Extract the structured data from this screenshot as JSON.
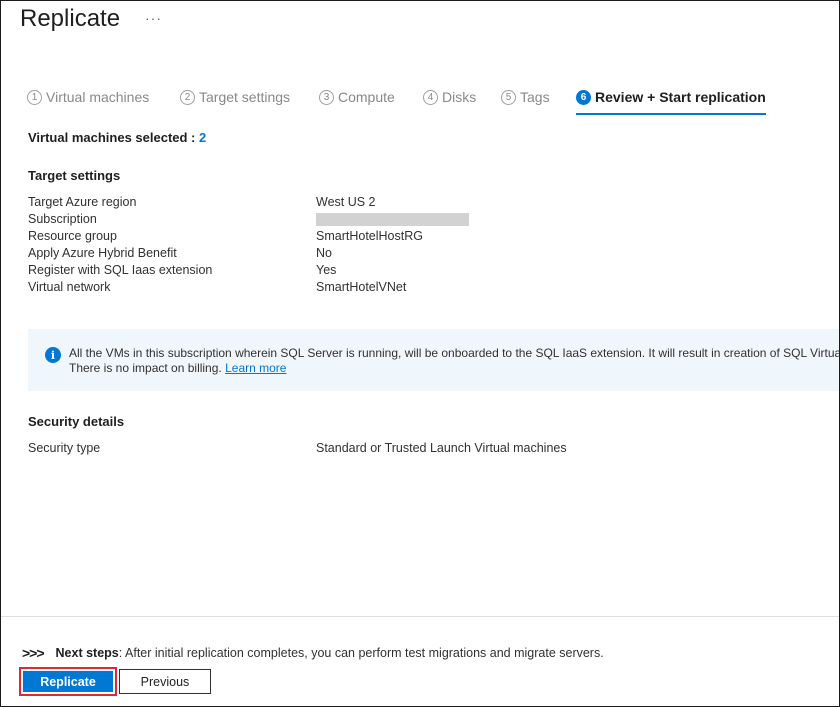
{
  "header": {
    "title": "Replicate",
    "more": "···"
  },
  "steps": [
    {
      "num": "1",
      "label": "Virtual machines"
    },
    {
      "num": "2",
      "label": "Target settings"
    },
    {
      "num": "3",
      "label": "Compute"
    },
    {
      "num": "4",
      "label": "Disks"
    },
    {
      "num": "5",
      "label": "Tags"
    },
    {
      "num": "6",
      "label": "Review + Start replication"
    }
  ],
  "summary": {
    "label": "Virtual machines selected :",
    "count": "2"
  },
  "target_settings": {
    "heading": "Target settings",
    "rows": [
      {
        "key": "Target Azure region",
        "value": "West US 2"
      },
      {
        "key": "Subscription",
        "value": ""
      },
      {
        "key": "Resource group",
        "value": "SmartHotelHostRG"
      },
      {
        "key": "Apply Azure Hybrid Benefit",
        "value": "No"
      },
      {
        "key": "Register with SQL Iaas extension",
        "value": "Yes"
      },
      {
        "key": "Virtual network",
        "value": "SmartHotelVNet"
      }
    ]
  },
  "info_banner": {
    "icon": "i",
    "line1": "All the VMs in this subscription wherein SQL Server is running, will be onboarded to the SQL IaaS extension. It will result in creation of SQL Virtual",
    "line2": "There is no impact on billing.",
    "link": "Learn more"
  },
  "security": {
    "heading": "Security details",
    "rows": [
      {
        "key": "Security type",
        "value": "Standard or Trusted Launch Virtual machines"
      }
    ]
  },
  "footer": {
    "chevrons": ">>>",
    "next_label": "Next steps",
    "next_text": ": After initial replication completes, you can perform test migrations and migrate servers.",
    "replicate_label": "Replicate",
    "previous_label": "Previous"
  }
}
